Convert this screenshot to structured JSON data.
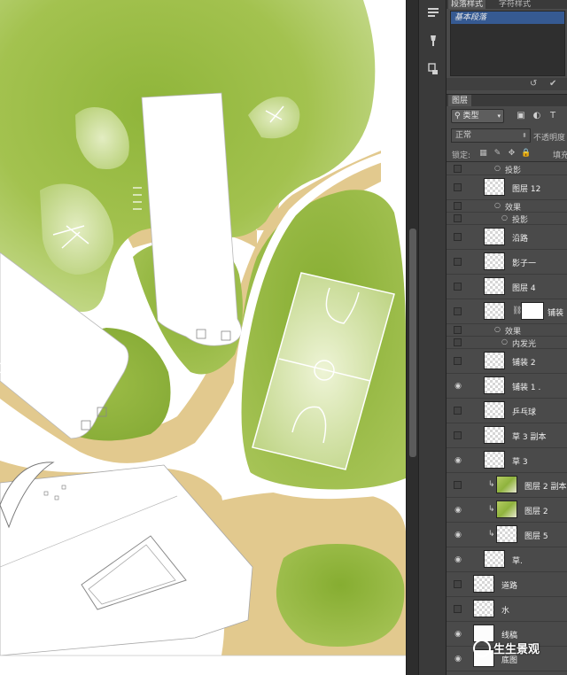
{
  "colors": {
    "grass": "#9bbd45",
    "grass_dark": "#7fa62e",
    "grass_light": "#c4d989",
    "path": "#e2c98e",
    "panel_bg": "#4a4a4a",
    "selected_style": "#365a92"
  },
  "toolstrip": {
    "icons": [
      "paragraph-panel-icon",
      "brush-preset-icon",
      "history-icon"
    ]
  },
  "paragraph_panel": {
    "tab_paragraph_styles": "段落样式",
    "tab_char_styles": "字符样式",
    "selected_style": "基本段落",
    "footer_icons": [
      "↺",
      "✔"
    ]
  },
  "layers_panel": {
    "tab_label": "图层",
    "filter_type": "类型",
    "blend_mode": "正常",
    "opacity_label": "不透明度",
    "lock_label": "锁定:",
    "fill_label": "填充",
    "rows": [
      {
        "kind": "sub",
        "text": "投影",
        "visible": false
      },
      {
        "kind": "layer",
        "name": "图层 12",
        "visible": false,
        "thumb": "transparent"
      },
      {
        "kind": "sub",
        "text": "效果",
        "visible": false
      },
      {
        "kind": "sub2",
        "text": "投影",
        "visible": false
      },
      {
        "kind": "layer",
        "name": "沿路",
        "visible": false,
        "thumb": "transparent"
      },
      {
        "kind": "layer",
        "name": "影子一",
        "visible": false,
        "thumb": "transparent"
      },
      {
        "kind": "layer",
        "name": "图层 4",
        "visible": false,
        "thumb": "transparent"
      },
      {
        "kind": "layer",
        "name": "铺装",
        "visible": false,
        "thumb": "transparent",
        "mask": true
      },
      {
        "kind": "sub",
        "text": "效果",
        "visible": false
      },
      {
        "kind": "sub2",
        "text": "内发光",
        "visible": false
      },
      {
        "kind": "layer",
        "name": "铺装 2",
        "visible": false,
        "thumb": "transparent"
      },
      {
        "kind": "layer",
        "name": "铺装 1 .",
        "visible": true,
        "thumb": "transparent"
      },
      {
        "kind": "layer",
        "name": "乒乓球",
        "visible": false,
        "thumb": "transparent"
      },
      {
        "kind": "layer",
        "name": "草 3  副本",
        "visible": false,
        "thumb": "transparent"
      },
      {
        "kind": "layer",
        "name": "草 3",
        "visible": true,
        "thumb": "transparent"
      },
      {
        "kind": "layer",
        "name": "图层 2 副本",
        "visible": false,
        "thumb": "green",
        "clip": true
      },
      {
        "kind": "layer",
        "name": "图层 2",
        "visible": true,
        "thumb": "green",
        "clip": true
      },
      {
        "kind": "layer",
        "name": "图层 5",
        "visible": true,
        "thumb": "transparent",
        "clip": true
      },
      {
        "kind": "layer",
        "name": "草.",
        "visible": true,
        "thumb": "transparent"
      },
      {
        "kind": "layer",
        "name": "道路",
        "visible": false,
        "thumb": "transparent",
        "outdent": true
      },
      {
        "kind": "layer",
        "name": "水",
        "visible": false,
        "thumb": "transparent",
        "outdent": true
      },
      {
        "kind": "layer",
        "name": "线稿",
        "visible": true,
        "thumb": "white",
        "outdent": true
      },
      {
        "kind": "layer",
        "name": "底图",
        "visible": true,
        "thumb": "white",
        "outdent": true
      }
    ]
  },
  "watermark": "生生景观"
}
